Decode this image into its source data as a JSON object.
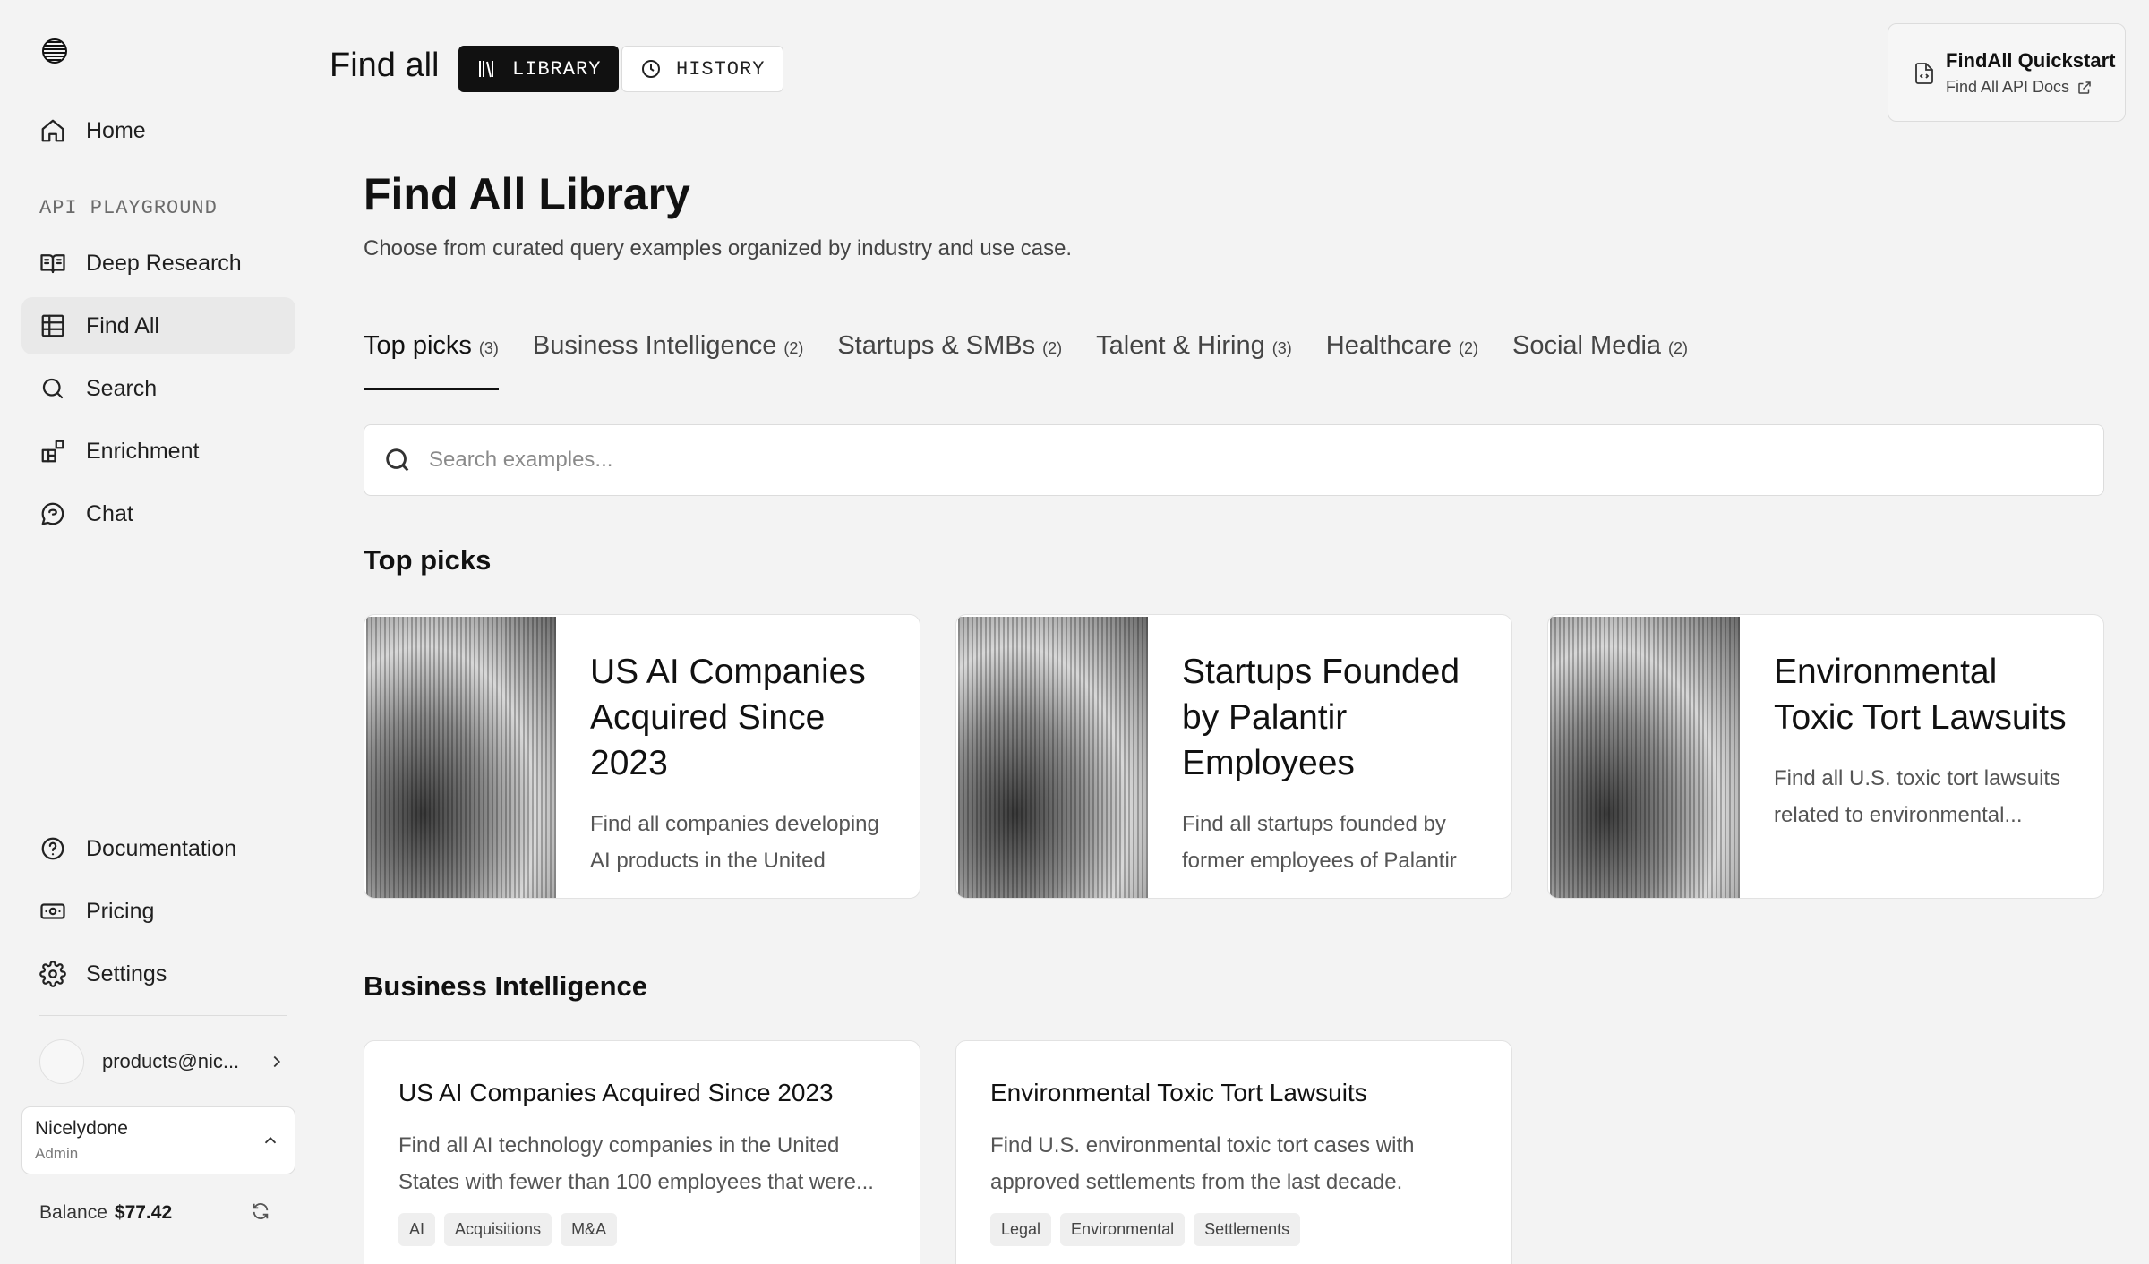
{
  "sidebar": {
    "home": "Home",
    "section_label": "API PLAYGROUND",
    "items": [
      {
        "label": "Deep Research"
      },
      {
        "label": "Find All"
      },
      {
        "label": "Search"
      },
      {
        "label": "Enrichment"
      },
      {
        "label": "Chat"
      }
    ],
    "bottom_items": [
      {
        "label": "Documentation"
      },
      {
        "label": "Pricing"
      },
      {
        "label": "Settings"
      }
    ],
    "user_email": "products@nic...",
    "org_name": "Nicelydone",
    "org_role": "Admin",
    "balance_label": "Balance",
    "balance_value": "$77.42"
  },
  "topbar": {
    "title": "Find all",
    "library": "LIBRARY",
    "history": "HISTORY"
  },
  "quickstart": {
    "title": "FindAll Quickstart",
    "subtitle": "Find All API Docs"
  },
  "main": {
    "title": "Find All Library",
    "subtitle": "Choose from curated query examples organized by industry and use case.",
    "tabs": [
      {
        "label": "Top picks",
        "count": "(3)"
      },
      {
        "label": "Business Intelligence",
        "count": "(2)"
      },
      {
        "label": "Startups & SMBs",
        "count": "(2)"
      },
      {
        "label": "Talent & Hiring",
        "count": "(3)"
      },
      {
        "label": "Healthcare",
        "count": "(2)"
      },
      {
        "label": "Social Media",
        "count": "(2)"
      }
    ],
    "search_placeholder": "Search examples...",
    "top_picks_heading": "Top picks",
    "top_picks": [
      {
        "title": "US AI Companies Acquired Since 2023",
        "desc": "Find all companies developing AI products in the United"
      },
      {
        "title": "Startups Founded by Palantir Employees",
        "desc": "Find all startups founded by former employees of Palantir"
      },
      {
        "title": "Environmental Toxic Tort Lawsuits",
        "desc": "Find all U.S. toxic tort lawsuits related to environmental..."
      }
    ],
    "bi_heading": "Business Intelligence",
    "bi_cards": [
      {
        "title": "US AI Companies Acquired Since 2023",
        "desc": "Find all AI technology companies in the United States with fewer than 100 employees that were...",
        "tags": [
          "AI",
          "Acquisitions",
          "M&A"
        ]
      },
      {
        "title": "Environmental Toxic Tort Lawsuits",
        "desc": "Find U.S. environmental toxic tort cases with approved settlements from the last decade.",
        "tags": [
          "Legal",
          "Environmental",
          "Settlements"
        ]
      }
    ]
  }
}
